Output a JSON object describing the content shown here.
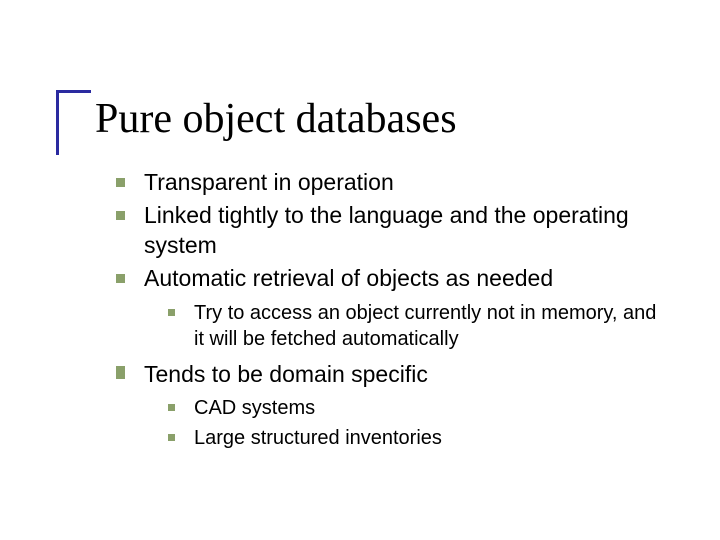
{
  "title": "Pure object databases",
  "bullets": {
    "b1": "Transparent in operation",
    "b2": "Linked tightly to the language and the operating system",
    "b3": "Automatic retrieval of objects as needed",
    "b3_1": "Try to access an object currently not in memory, and it will be fetched automatically",
    "b4": "Tends to be domain specific",
    "b4_1": "CAD systems",
    "b4_2": "Large structured inventories"
  }
}
